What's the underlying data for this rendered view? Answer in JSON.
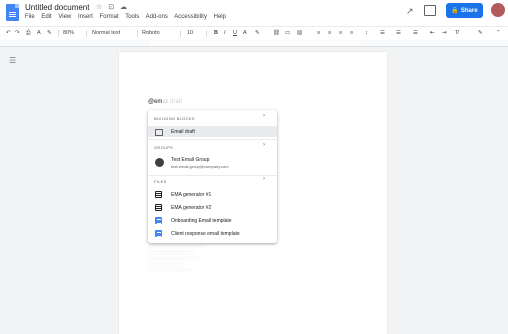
{
  "doc": {
    "title": "Untitled document",
    "title_icons": "☆ ⊡ ☁"
  },
  "menu": [
    "File",
    "Edit",
    "View",
    "Insert",
    "Format",
    "Tools",
    "Add-ons",
    "Accessibility",
    "Help"
  ],
  "share": {
    "label": "Share",
    "icon": "lock-icon"
  },
  "toolbar": {
    "zoom": "80%",
    "style": "Normal text",
    "font": "Roboto",
    "size": "10"
  },
  "typed": {
    "text": "@em",
    "hint": "ail draft"
  },
  "popup": {
    "building_blocks": "BUILDING BLOCKS",
    "email_draft": "Email draft",
    "groups": "GROUPS",
    "group_name": "Test Email Group",
    "group_email": "test-email-group@company.com",
    "files": "FILES",
    "file1": "EMA generator #1",
    "file2": "EMA generator #2",
    "file3": "Onboarding Email template",
    "file4": "Client response email template"
  },
  "colors": {
    "accent": "#1a73e8",
    "doc_blue": "#4285f4"
  }
}
